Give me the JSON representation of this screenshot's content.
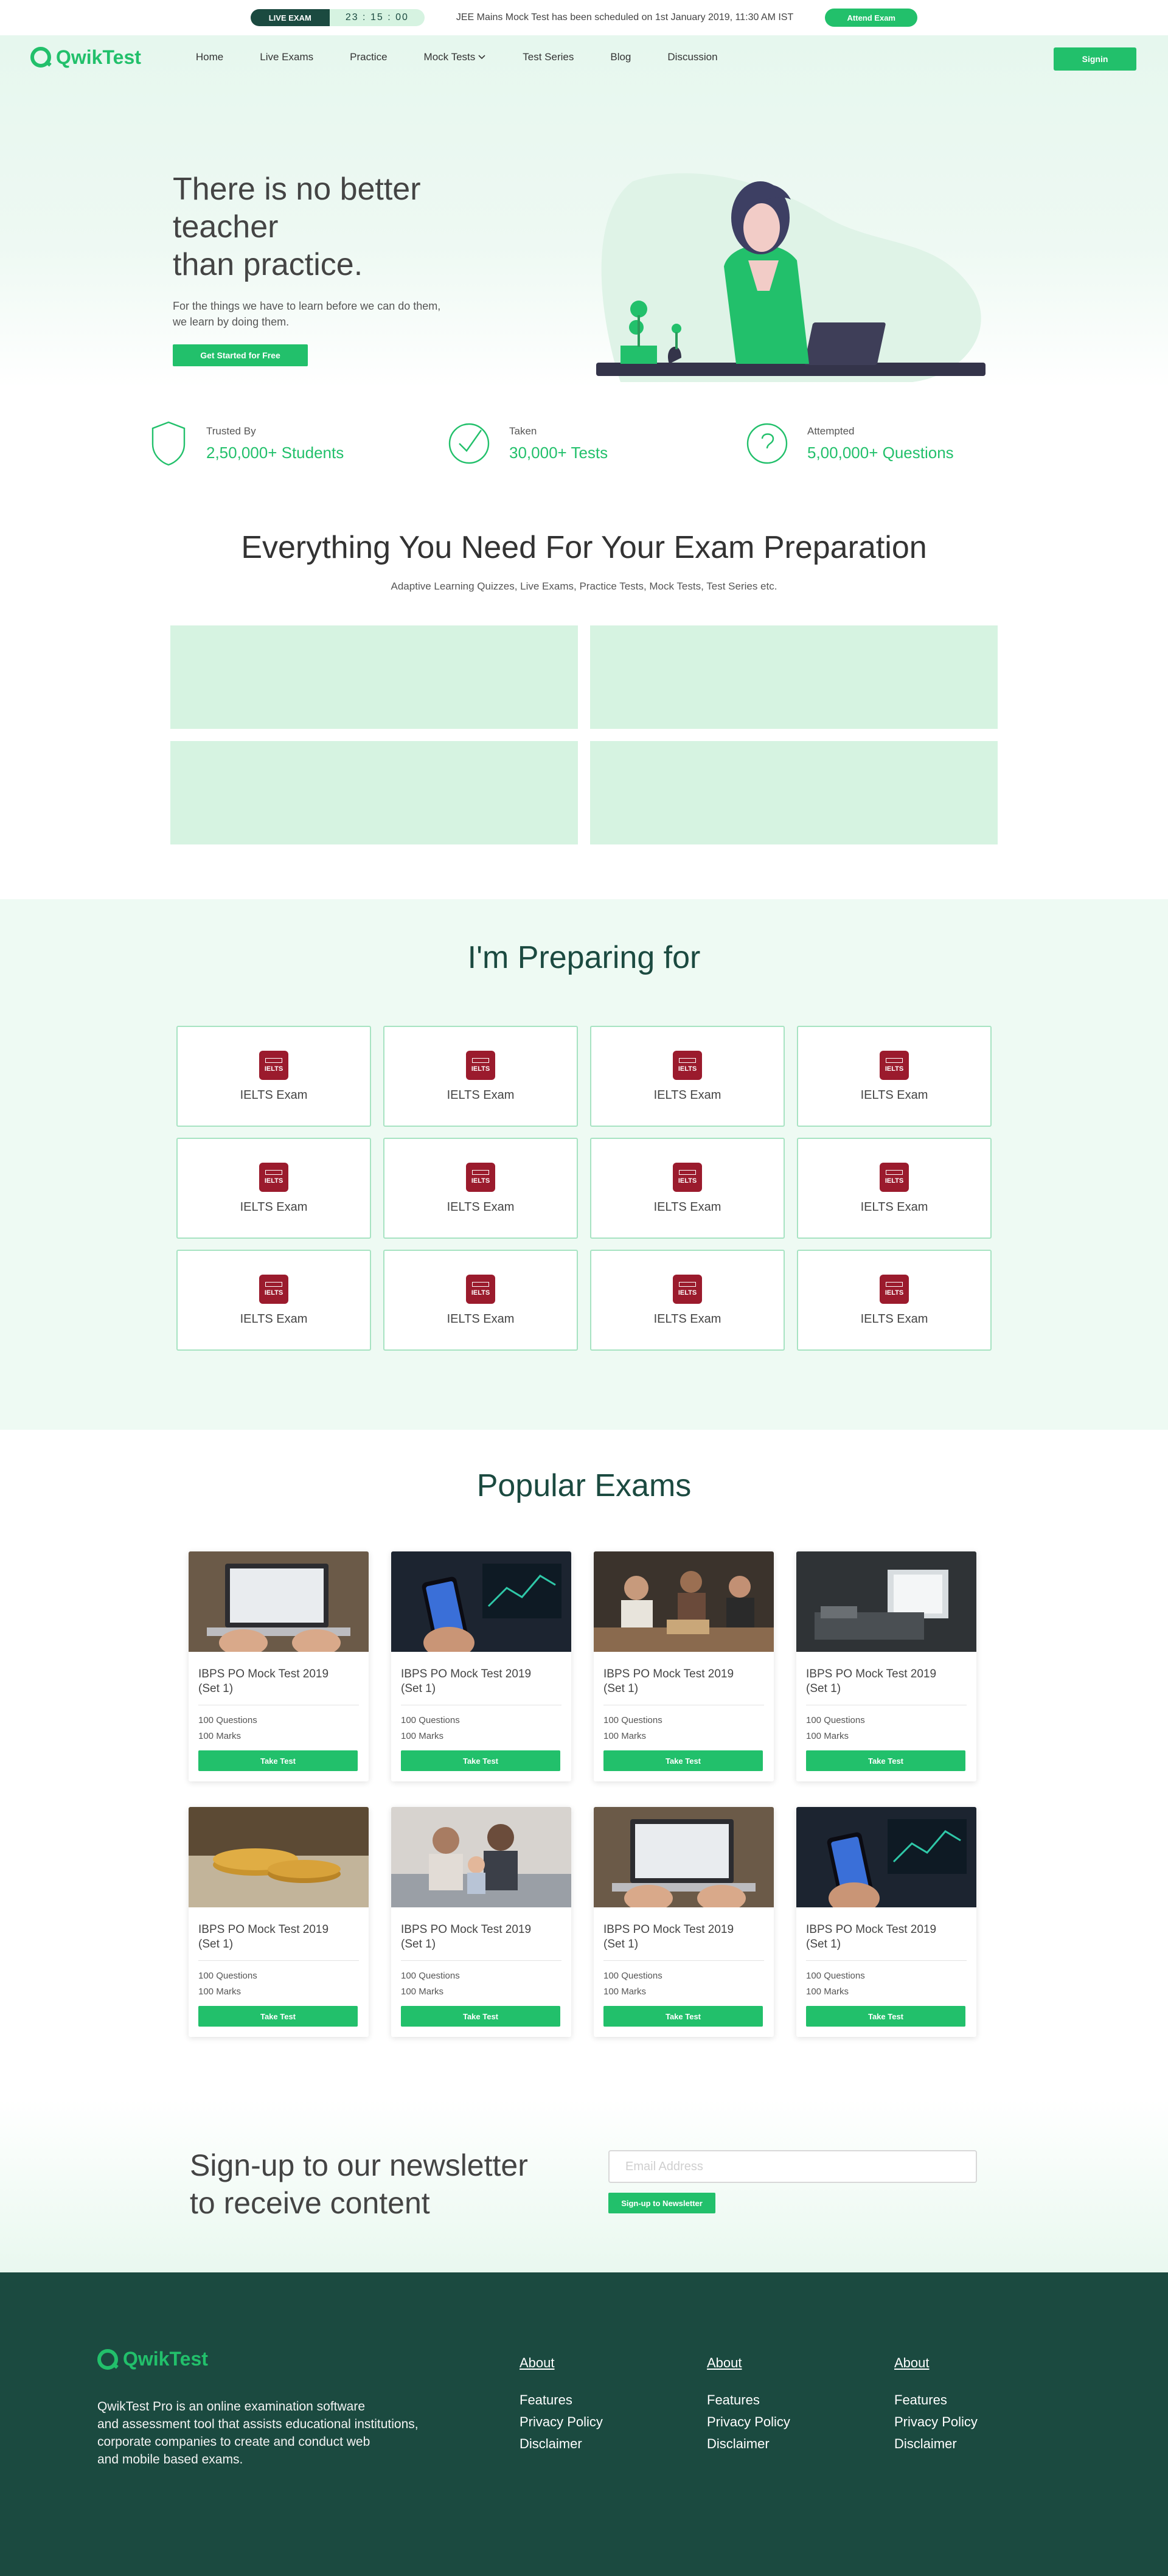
{
  "livebar": {
    "tag": "LIVE EXAM",
    "timer": "23 : 15 : 00",
    "notice": "JEE Mains Mock Test has been scheduled on 1st January 2019, 11:30 AM IST",
    "attend_label": "Attend Exam"
  },
  "brand": {
    "name": "QwikTest",
    "color": "#22c06b",
    "dark": "#1b4a40"
  },
  "nav": {
    "items": [
      "Home",
      "Live Exams",
      "Practice",
      "Mock Tests",
      "Test Series",
      "Blog",
      "Discussion"
    ],
    "signin_label": "Signin"
  },
  "hero": {
    "title_line1": "There is no better teacher",
    "title_line2": "than practice.",
    "subtitle_line1": "For the things we have to learn before we can do them,",
    "subtitle_line2": "we learn by doing them.",
    "cta_label": "Get Started for Free"
  },
  "stats": [
    {
      "label": "Trusted By",
      "value": "2,50,000+ Students",
      "icon": "shield-icon"
    },
    {
      "label": "Taken",
      "value": "30,000+ Tests",
      "icon": "check-circle-icon"
    },
    {
      "label": "Attempted",
      "value": "5,00,000+ Questions",
      "icon": "question-icon"
    }
  ],
  "everything": {
    "title": "Everything You Need For Your Exam Preparation",
    "subtitle": "Adaptive Learning Quizzes, Live Exams, Practice Tests, Mock Tests, Test Series etc."
  },
  "preparing": {
    "title": "I'm Preparing for",
    "badge_text": "IELTS",
    "exams": [
      "IELTS Exam",
      "IELTS Exam",
      "IELTS Exam",
      "IELTS Exam",
      "IELTS Exam",
      "IELTS Exam",
      "IELTS Exam",
      "IELTS Exam",
      "IELTS Exam",
      "IELTS Exam",
      "IELTS Exam",
      "IELTS Exam"
    ]
  },
  "popular": {
    "title": "Popular Exams",
    "cards": [
      {
        "title_line1": "IBPS PO Mock Test 2019",
        "title_line2": "(Set 1)",
        "questions": "100 Questions",
        "marks": "100 Marks",
        "button": "Take Test",
        "image": "laptop-hands"
      },
      {
        "title_line1": "IBPS PO Mock Test 2019",
        "title_line2": "(Set 1)",
        "questions": "100 Questions",
        "marks": "100 Marks",
        "button": "Take Test",
        "image": "phone-trading"
      },
      {
        "title_line1": "IBPS PO Mock Test 2019",
        "title_line2": "(Set 1)",
        "questions": "100 Questions",
        "marks": "100 Marks",
        "button": "Take Test",
        "image": "friends-table"
      },
      {
        "title_line1": "IBPS PO Mock Test 2019",
        "title_line2": "(Set 1)",
        "questions": "100 Questions",
        "marks": "100 Marks",
        "button": "Take Test",
        "image": "dark-room"
      },
      {
        "title_line1": "IBPS PO Mock Test 2019",
        "title_line2": "(Set 1)",
        "questions": "100 Questions",
        "marks": "100 Marks",
        "button": "Take Test",
        "image": "gold-coins"
      },
      {
        "title_line1": "IBPS PO Mock Test 2019",
        "title_line2": "(Set 1)",
        "questions": "100 Questions",
        "marks": "100 Marks",
        "button": "Take Test",
        "image": "family-sofa"
      },
      {
        "title_line1": "IBPS PO Mock Test 2019",
        "title_line2": "(Set 1)",
        "questions": "100 Questions",
        "marks": "100 Marks",
        "button": "Take Test",
        "image": "laptop-hands"
      },
      {
        "title_line1": "IBPS PO Mock Test 2019",
        "title_line2": "(Set 1)",
        "questions": "100 Questions",
        "marks": "100 Marks",
        "button": "Take Test",
        "image": "phone-trading"
      }
    ]
  },
  "newsletter": {
    "title_line1": "Sign-up to our newsletter",
    "title_line2": "to receive content",
    "email_placeholder": "Email Address",
    "button": "Sign-up to Newsletter"
  },
  "footer": {
    "desc_line1": "QwikTest Pro is an online examination software",
    "desc_line2": "and assessment tool that assists educational institutions,",
    "desc_line3": "corporate companies to create and conduct web",
    "desc_line4": "and mobile based exams.",
    "columns": [
      {
        "heading": "About",
        "links": [
          "Features",
          "Privacy Policy",
          "Disclaimer"
        ]
      },
      {
        "heading": "About",
        "links": [
          "Features",
          "Privacy Policy",
          "Disclaimer"
        ]
      },
      {
        "heading": "About",
        "links": [
          "Features",
          "Privacy Policy",
          "Disclaimer"
        ]
      }
    ]
  }
}
